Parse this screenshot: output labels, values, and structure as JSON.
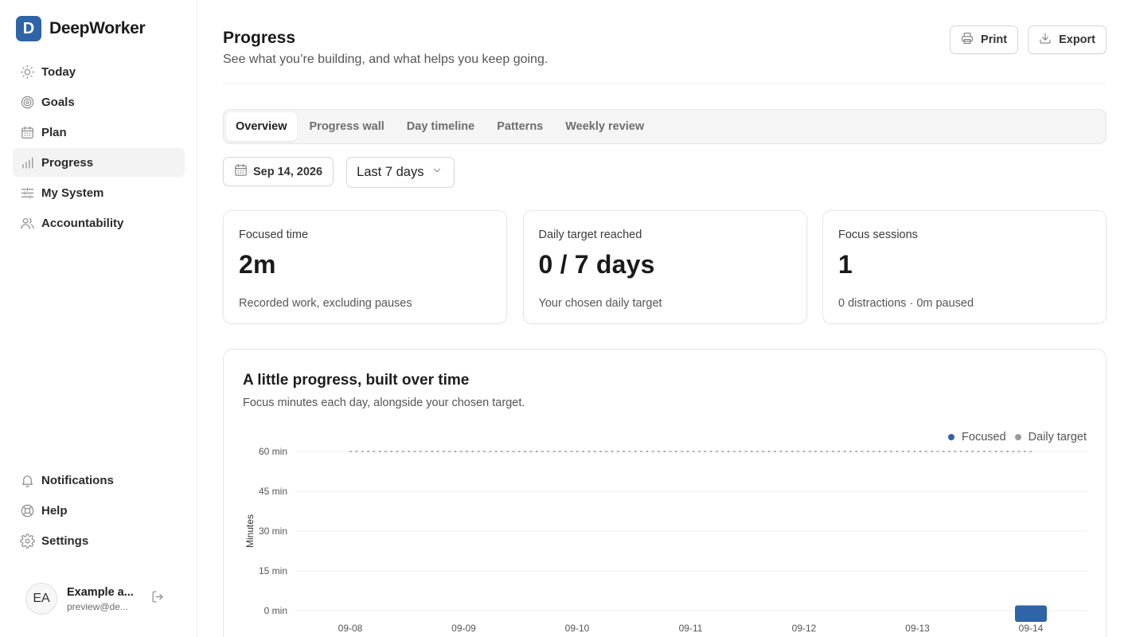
{
  "app": {
    "name": "DeepWorker",
    "logo_letter": "D"
  },
  "sidebar": {
    "nav_top": [
      {
        "label": "Today",
        "icon": "sun-icon"
      },
      {
        "label": "Goals",
        "icon": "target-icon"
      },
      {
        "label": "Plan",
        "icon": "calendar-icon"
      },
      {
        "label": "Progress",
        "icon": "bar-chart-icon",
        "active": true
      },
      {
        "label": "My System",
        "icon": "sliders-icon"
      },
      {
        "label": "Accountability",
        "icon": "users-icon"
      }
    ],
    "nav_bottom": [
      {
        "label": "Notifications",
        "icon": "bell-icon"
      },
      {
        "label": "Help",
        "icon": "lifebuoy-icon"
      },
      {
        "label": "Settings",
        "icon": "gear-icon"
      }
    ],
    "user": {
      "initials": "EA",
      "name": "Example a...",
      "email": "preview@de..."
    }
  },
  "header": {
    "title": "Progress",
    "subtitle": "See what you’re building, and what helps you keep going.",
    "print_label": "Print",
    "export_label": "Export"
  },
  "tabs": [
    {
      "label": "Overview",
      "active": true
    },
    {
      "label": "Progress wall"
    },
    {
      "label": "Day timeline"
    },
    {
      "label": "Patterns"
    },
    {
      "label": "Weekly review"
    }
  ],
  "filters": {
    "date": "Sep 14, 2026",
    "range": "Last 7 days"
  },
  "stats": [
    {
      "label": "Focused time",
      "value": "2m",
      "description": "Recorded work, excluding pauses"
    },
    {
      "label": "Daily target reached",
      "value": "0 / 7 days",
      "description": "Your chosen daily target"
    },
    {
      "label": "Focus sessions",
      "value": "1",
      "description": "0 distractions · 0m paused"
    }
  ],
  "colors": {
    "focused": "#2f64a7",
    "target": "#9a9a9a",
    "accent": "#2f64a7"
  },
  "chart_data": {
    "type": "bar",
    "title": "A little progress, built over time",
    "subtitle": "Focus minutes each day, alongside your chosen target.",
    "ylabel": "Minutes",
    "xlabel": "",
    "ylim": [
      0,
      60
    ],
    "yticks": [
      0,
      15,
      30,
      45,
      60
    ],
    "ytick_labels": [
      "0 min",
      "15 min",
      "30 min",
      "45 min",
      "60 min"
    ],
    "categories": [
      "09-08",
      "09-09",
      "09-10",
      "09-11",
      "09-12",
      "09-13",
      "09-14"
    ],
    "series": [
      {
        "name": "Focused",
        "values": [
          0,
          0,
          0,
          0,
          0,
          0,
          2
        ]
      },
      {
        "name": "Daily target",
        "values": [
          60,
          60,
          60,
          60,
          60,
          60,
          60
        ]
      }
    ],
    "legend": "top-right",
    "grid": true
  }
}
